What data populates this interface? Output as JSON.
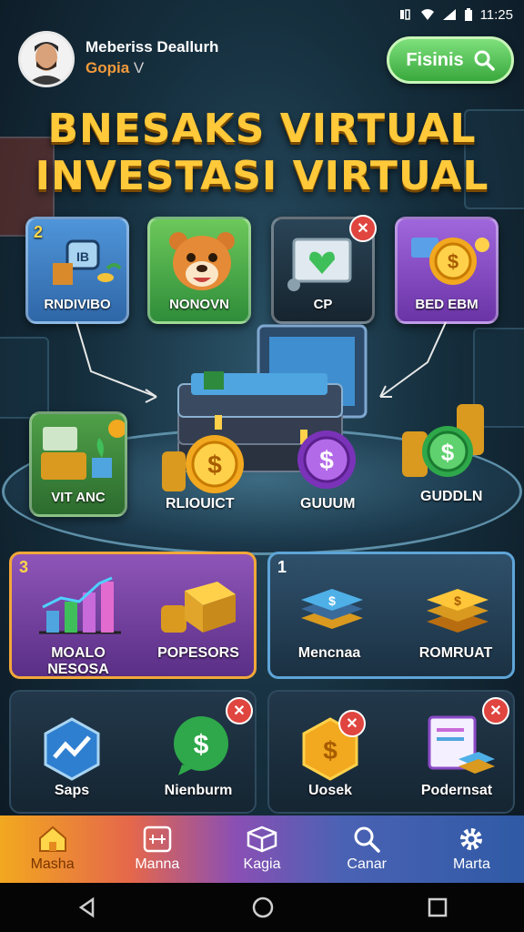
{
  "status_bar": {
    "time": "11:25"
  },
  "user": {
    "name": "Meberiss Deallurh",
    "subtitle": "Gopia",
    "level": "V"
  },
  "search_button": {
    "label": "Fisinis"
  },
  "title": {
    "line1": "BNESAKS VIRTUAL",
    "line2": "INVESTASI VIRTUAL"
  },
  "top_cards": [
    {
      "label": "RNDIVIBO",
      "badge": "2",
      "color": "#3f7fc2"
    },
    {
      "label": "NONOVN",
      "color": "#3ea24b"
    },
    {
      "label": "CP",
      "color": "#1d3140"
    },
    {
      "label": "BED EBM",
      "color": "#8b4bc7"
    }
  ],
  "platform_items": [
    {
      "label": "VIT ANC"
    },
    {
      "label": "RLIOUICT"
    },
    {
      "label": "GUUUM"
    },
    {
      "label": "GUDDLN"
    }
  ],
  "panels": {
    "left": {
      "number": "3",
      "items": [
        "MOALO NESOSA",
        "POPESORS"
      ]
    },
    "right": {
      "number": "1",
      "items": [
        "Mencnaa",
        "ROMRUAT"
      ]
    },
    "bottom_left": {
      "items": [
        "Saps",
        "Nienburm"
      ]
    },
    "bottom_right": {
      "items": [
        "Uosek",
        "Podernsat"
      ]
    }
  },
  "bottom_nav": [
    {
      "label": "Masha",
      "icon": "home-icon"
    },
    {
      "label": "Manna",
      "icon": "tile-icon"
    },
    {
      "label": "Kagia",
      "icon": "box-icon"
    },
    {
      "label": "Canar",
      "icon": "search-icon"
    },
    {
      "label": "Marta",
      "icon": "gear-icon"
    }
  ],
  "colors": {
    "title": "#ffc93a",
    "accent_green": "#39a83d",
    "nav_active": "#f2a81f"
  }
}
